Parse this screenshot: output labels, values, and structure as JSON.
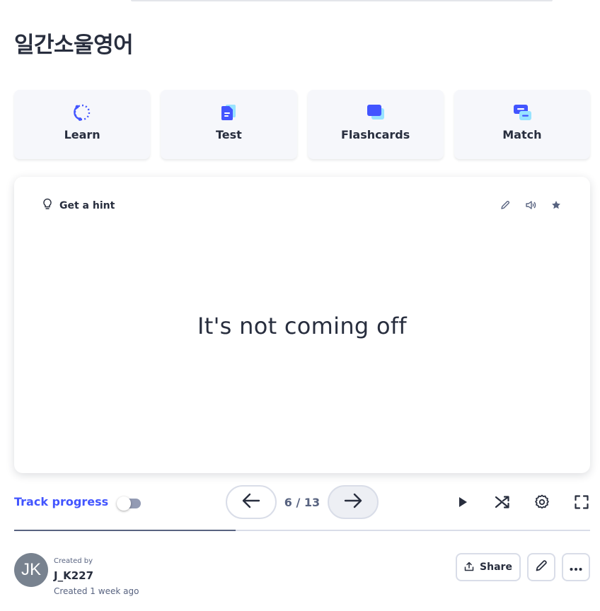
{
  "set": {
    "title": "일간소울영어"
  },
  "modes": [
    {
      "label": "Learn",
      "icon": "learn-icon"
    },
    {
      "label": "Test",
      "icon": "test-icon"
    },
    {
      "label": "Flashcards",
      "icon": "flashcards-icon"
    },
    {
      "label": "Match",
      "icon": "match-icon"
    }
  ],
  "card": {
    "hint_label": "Get a hint",
    "term": "It's not coming off",
    "tools": [
      "edit-icon",
      "audio-icon",
      "star-icon"
    ]
  },
  "controls": {
    "track_label": "Track progress",
    "track_enabled": false,
    "counter": "6 / 13",
    "current": 6,
    "total": 13,
    "progress_fraction": 0.3846
  },
  "author": {
    "initials": "JK",
    "created_by_label": "Created by",
    "name": "J_K227",
    "created_when": "Created 1 week ago"
  },
  "actions": {
    "share_label": "Share"
  },
  "colors": {
    "accent": "#4255ff",
    "text": "#282e3e",
    "muted": "#586380",
    "tile_bg": "#f6f7fb",
    "avatar_bg": "#78828f"
  }
}
